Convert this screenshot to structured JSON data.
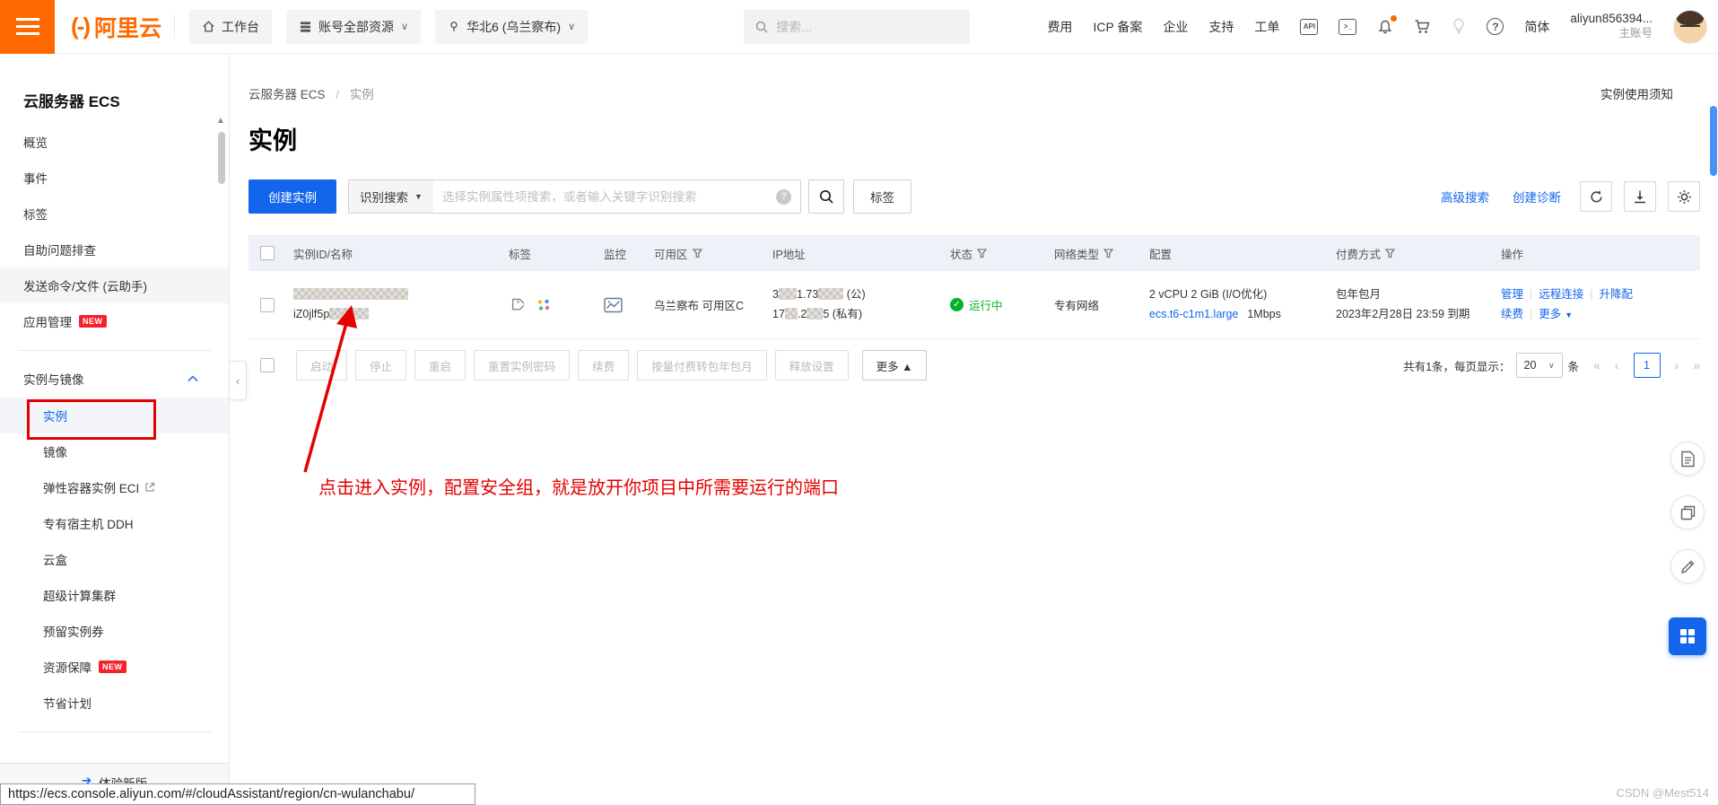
{
  "colors": {
    "brand_orange": "#ff6a00",
    "primary_blue": "#1366ec",
    "status_green": "#00b42a",
    "annotation_red": "#e60000"
  },
  "topbar": {
    "logo_text": "阿里云",
    "workbench": "工作台",
    "resources": "账号全部资源",
    "region": "华北6 (乌兰察布)",
    "search_placeholder": "搜索...",
    "links": [
      "费用",
      "ICP 备案",
      "企业",
      "支持",
      "工单"
    ],
    "lang": "简体",
    "account_name": "aliyun856394...",
    "account_type": "主账号"
  },
  "sidebar": {
    "title": "云服务器 ECS",
    "items": [
      "概览",
      "事件",
      "标签",
      "自助问题排查",
      "发送命令/文件 (云助手)",
      "应用管理"
    ],
    "badge_new": "NEW",
    "group_label": "实例与镜像",
    "sub_items": [
      "实例",
      "镜像",
      "弹性容器实例 ECI",
      "专有宿主机 DDH",
      "云盒",
      "超级计算集群",
      "预留实例券",
      "资源保障",
      "节省计划"
    ],
    "footer": "体验新版"
  },
  "page": {
    "breadcrumb_root": "云服务器 ECS",
    "breadcrumb_current": "实例",
    "notice_link": "实例使用须知",
    "title": "实例"
  },
  "toolbar": {
    "create": "创建实例",
    "search_mode": "识别搜索",
    "search_placeholder": "选择实例属性项搜索，或者输入关键字识别搜索",
    "tag": "标签",
    "advanced_search": "高级搜索",
    "create_diagnosis": "创建诊断"
  },
  "table": {
    "headers": [
      "实例ID/名称",
      "标签",
      "监控",
      "可用区",
      "IP地址",
      "状态",
      "网络类型",
      "配置",
      "付费方式",
      "操作"
    ],
    "row": {
      "instance_id": "iZ0jlf5p",
      "zone": "乌兰察布 可用区C",
      "ip_public_1": "3",
      "ip_public_2": "1.73",
      "ip_public_3": "(公)",
      "ip_private_1": "17",
      "ip_private_2": ".2",
      "ip_private_3": "5 (私有)",
      "status": "运行中",
      "network_type": "专有网络",
      "config_spec": "2 vCPU 2 GiB (I/O优化)",
      "config_type": "ecs.t6-c1m1.large",
      "bandwidth": "1Mbps",
      "pay_type": "包年包月",
      "expire": "2023年2月28日 23:59 到期",
      "op_manage": "管理",
      "op_remote": "远程连接",
      "op_resize": "升降配",
      "op_renew": "续费",
      "op_more": "更多"
    }
  },
  "batchbar": {
    "buttons": [
      "启动",
      "停止",
      "重启",
      "重置实例密码",
      "续费",
      "按量付费转包年包月",
      "释放设置"
    ],
    "more": "更多",
    "total_text": "共有1条，每页显示：",
    "page_size": "20",
    "unit": "条",
    "current_page": "1"
  },
  "annotation": {
    "text": "点击进入实例，配置安全组，就是放开你项目中所需要运行的端口"
  },
  "statusbar": {
    "url": "https://ecs.console.aliyun.com/#/cloudAssistant/region/cn-wulanchabu/"
  },
  "watermark": "CSDN @Mest514"
}
